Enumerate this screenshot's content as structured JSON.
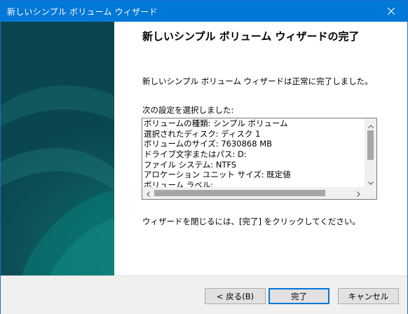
{
  "window": {
    "title": "新しいシンプル ボリューム ウィザード"
  },
  "colors": {
    "titlebar": "#0078d7",
    "side_panel": "#0c5358",
    "footer": "#f0f0f0",
    "primary_border": "#0078d7"
  },
  "icons": {
    "close": "close-icon",
    "scroll_up": "chevron-up-icon",
    "scroll_down": "chevron-down-icon",
    "scroll_left": "chevron-left-icon",
    "scroll_right": "chevron-right-icon"
  },
  "main": {
    "heading": "新しいシンプル ボリューム ウィザードの完了",
    "completed_message": "新しいシンプル ボリューム ウィザードは正常に完了しました。",
    "selected_settings_label": "次の設定を選択しました:",
    "settings": [
      "ボリュームの種類: シンプル ボリューム",
      "選択されたディスク: ディスク 1",
      "ボリュームのサイズ: 7630868 MB",
      "ドライブ文字またはパス: D:",
      "ファイル システム: NTFS",
      "アロケーション ユニット サイズ: 既定値",
      "ボリューム ラベル:"
    ],
    "close_instruction": "ウィザードを閉じるには、[完了] をクリックしてください。"
  },
  "buttons": {
    "back": "< 戻る(B)",
    "finish": "完了",
    "cancel": "キャンセル"
  }
}
